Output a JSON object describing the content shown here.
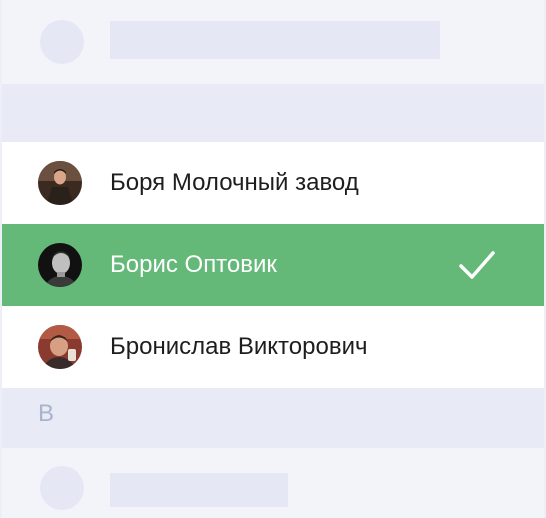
{
  "contacts": [
    {
      "name": "Боря Молочный завод",
      "selected": false
    },
    {
      "name": "Борис Оптовик",
      "selected": true
    },
    {
      "name": "Бронислав Викторович",
      "selected": false
    }
  ],
  "section_letter": "В",
  "icons": {
    "selected_mark": "checkmark-icon"
  },
  "colors": {
    "selected_row": "#64b978",
    "page_background": "#edeef6",
    "placeholder": "#e5e7f5",
    "section_letter": "#a7b4cc"
  }
}
